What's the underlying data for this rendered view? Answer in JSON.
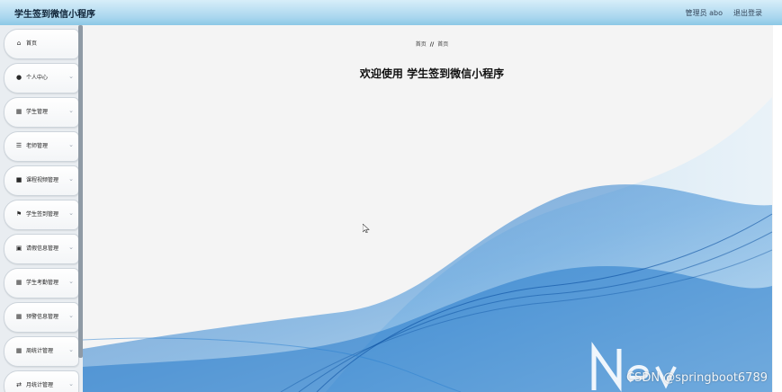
{
  "header": {
    "app_title": "学生签到微信小程序",
    "admin_label": "管理员 abo",
    "logout_label": "退出登录"
  },
  "sidebar": {
    "items": [
      {
        "label": "首页",
        "icon": "home-icon",
        "has_chevron": false
      },
      {
        "label": "个人中心",
        "icon": "user-icon",
        "has_chevron": true
      },
      {
        "label": "学生管理",
        "icon": "grid-icon",
        "has_chevron": true
      },
      {
        "label": "老师管理",
        "icon": "list-icon",
        "has_chevron": true
      },
      {
        "label": "课程视频管理",
        "icon": "chat-bubble-icon",
        "has_chevron": true
      },
      {
        "label": "学生签到管理",
        "icon": "flag-icon",
        "has_chevron": true
      },
      {
        "label": "请假信息管理",
        "icon": "briefcase-icon",
        "has_chevron": true
      },
      {
        "label": "学生考勤管理",
        "icon": "table-icon",
        "has_chevron": true
      },
      {
        "label": "预警信息管理",
        "icon": "grid-icon",
        "has_chevron": true
      },
      {
        "label": "周统计管理",
        "icon": "grid-icon",
        "has_chevron": true
      },
      {
        "label": "月统计管理",
        "icon": "shuffle-icon",
        "has_chevron": true
      }
    ]
  },
  "main": {
    "breadcrumb": {
      "home": "首页",
      "separator": "//",
      "current": "首页"
    },
    "welcome_text": "欢迎使用 学生签到微信小程序"
  },
  "watermark": "CSDN @springboot6789",
  "colors": {
    "header_gradient_top": "#d7eef9",
    "header_gradient_bottom": "#8cc8e6",
    "wave": "#1b73c8"
  }
}
